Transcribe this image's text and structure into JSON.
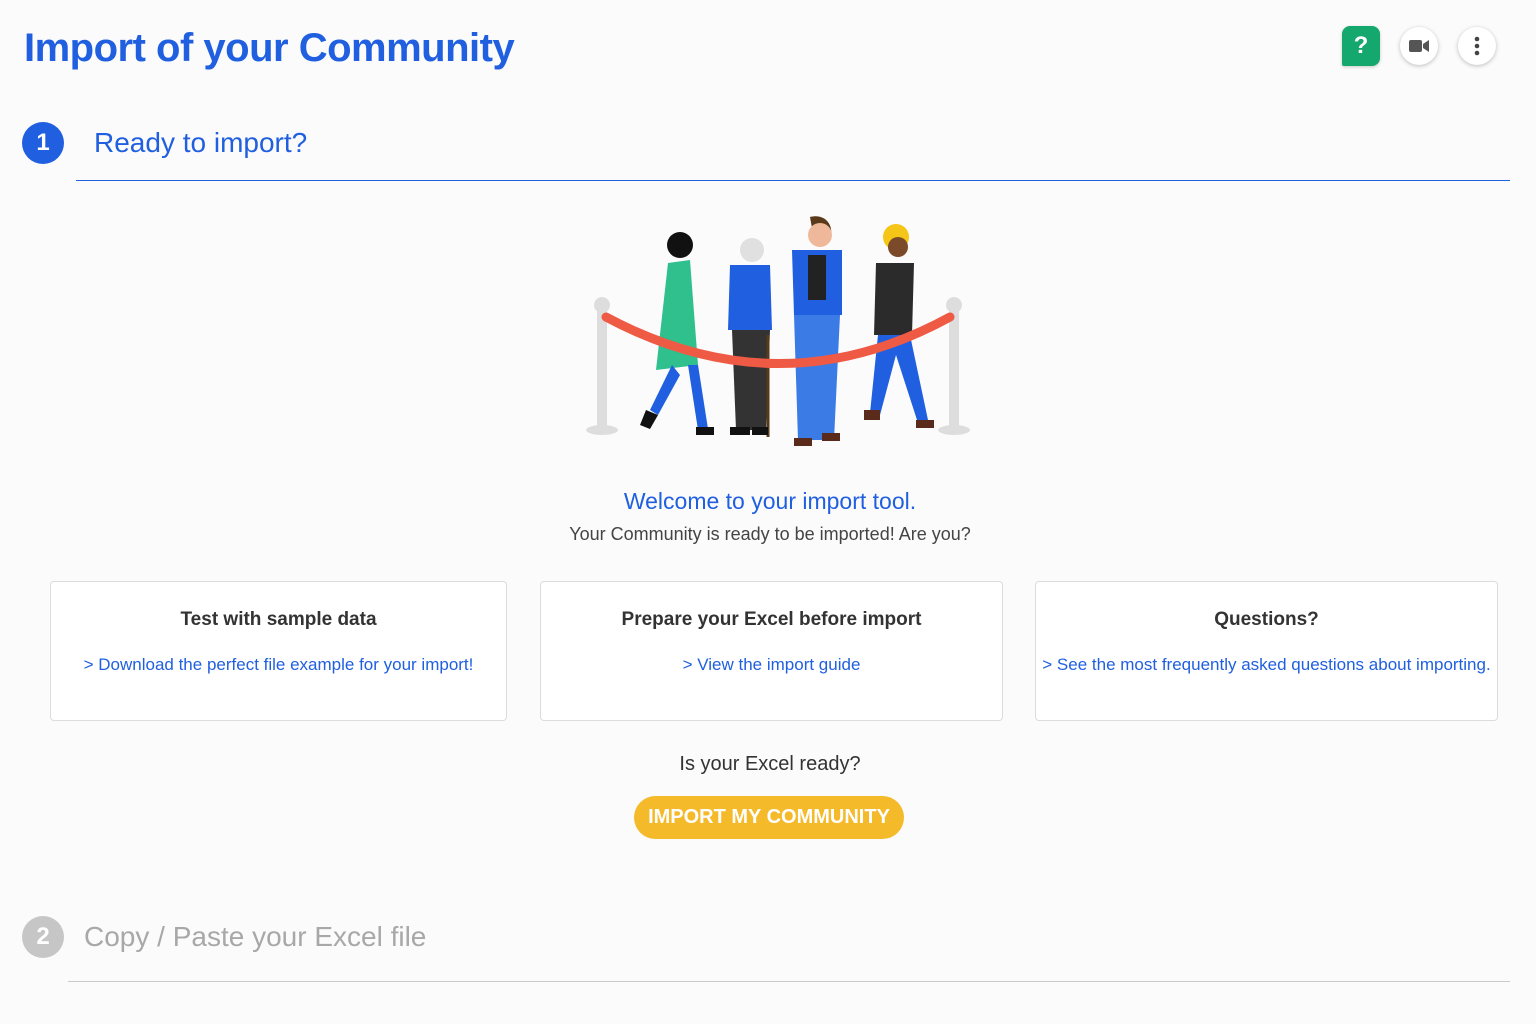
{
  "header": {
    "title": "Import of your Community",
    "help_label": "?",
    "icons": [
      "question-icon",
      "video-camera-icon",
      "more-vertical-icon"
    ]
  },
  "steps": [
    {
      "number": "1",
      "label": "Ready to import?"
    },
    {
      "number": "2",
      "label": "Copy / Paste your Excel file"
    }
  ],
  "welcome": {
    "title": "Welcome to your import tool.",
    "subtitle": "Your Community is ready to be imported! Are you?"
  },
  "cards": [
    {
      "title": "Test with sample data",
      "link": "> Download the perfect file example for your import!"
    },
    {
      "title": "Prepare your Excel before import",
      "link": "> View the import guide"
    },
    {
      "title": "Questions?",
      "link": "> See the most frequently asked questions about importing."
    }
  ],
  "cta": {
    "question": "Is your Excel ready?",
    "button_label": "IMPORT MY COMMUNITY"
  },
  "colors": {
    "primary": "#1f5fe0",
    "help_green": "#14a86e",
    "cta_yellow": "#f4ba2a",
    "disabled_gray": "#c6c6c6"
  }
}
